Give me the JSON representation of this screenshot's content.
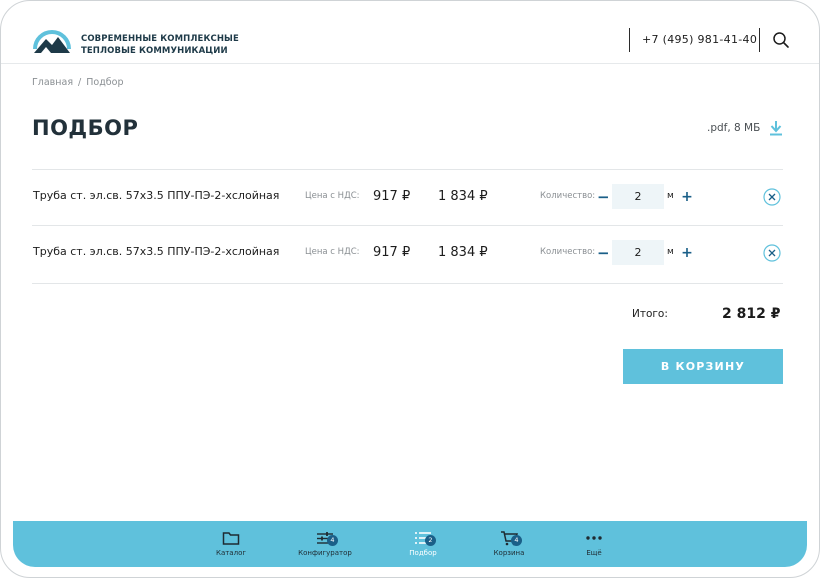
{
  "header": {
    "brand_line1": "СОВРЕМЕННЫЕ КОМПЛЕКСНЫЕ",
    "brand_line2": "ТЕПЛОВЫЕ КОММУНИКАЦИИ",
    "phone": "+7 (495) 981-41-40"
  },
  "breadcrumb": {
    "home": "Главная",
    "separator": "/",
    "current": "Подбор"
  },
  "page": {
    "title": "ПОДБОР",
    "pdf_label": ".pdf, 8 МБ"
  },
  "items": [
    {
      "name": "Труба ст. эл.св. 57х3.5 ППУ-ПЭ-2-хслойная",
      "price_label": "Цена с НДС:",
      "price": "917 ₽",
      "total": "1 834 ₽",
      "qty_label": "Количество:",
      "qty": "2",
      "unit": "м"
    },
    {
      "name": "Труба ст. эл.св. 57х3.5 ППУ-ПЭ-2-хслойная",
      "price_label": "Цена с НДС:",
      "price": "917 ₽",
      "total": "1 834 ₽",
      "qty_label": "Количество:",
      "qty": "2",
      "unit": "м"
    }
  ],
  "summary": {
    "label": "Итого:",
    "value": "2 812 ₽"
  },
  "cart_button": "В КОРЗИНУ",
  "bottom_nav": [
    {
      "label": "Каталог",
      "icon": "folder-icon",
      "badge": ""
    },
    {
      "label": "Конфигуратор",
      "icon": "sliders-icon",
      "badge": "4"
    },
    {
      "label": "Подбор",
      "icon": "list-icon",
      "badge": "2"
    },
    {
      "label": "Корзина",
      "icon": "cart-icon",
      "badge": "4"
    },
    {
      "label": "Ещё",
      "icon": "more-dots-icon",
      "badge": ""
    }
  ],
  "colors": {
    "accent": "#5fc1dc",
    "dark_blue": "#1a5f88",
    "title": "#22313a"
  }
}
